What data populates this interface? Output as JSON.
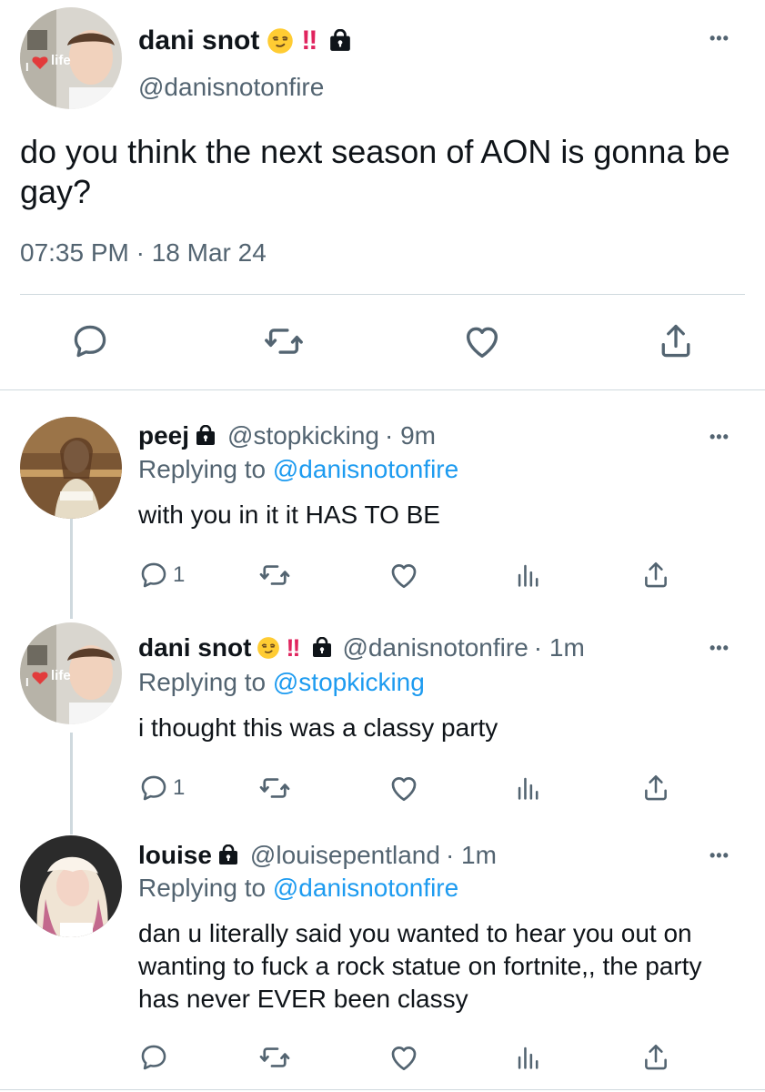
{
  "main_tweet": {
    "name": "dani snot",
    "bang": "!!",
    "handle": "@danisnotonfire",
    "text": "do you think the next season of AON is gonna be gay?",
    "timestamp": "07:35 PM · 18 Mar 24",
    "more": "•••",
    "avatar_sign": "life",
    "avatar_sign_prefix": "I"
  },
  "replies": [
    {
      "name": "peej",
      "handle": "@stopkicking",
      "time": "· 9m",
      "replying_prefix": "Replying to",
      "replying_to": "@danisnotonfire",
      "text": "with you in it it HAS TO BE",
      "reply_count": "1",
      "more": "•••"
    },
    {
      "name": "dani snot",
      "bang": "!!",
      "handle": "@danisnotonfire",
      "time": "· 1m",
      "replying_prefix": "Replying to",
      "replying_to": "@stopkicking",
      "text": "i thought this was a classy party",
      "reply_count": "1",
      "more": "•••",
      "avatar_sign": "life",
      "avatar_sign_prefix": "I"
    },
    {
      "name": "louise",
      "handle": "@louisepentland",
      "time": "· 1m",
      "replying_prefix": "Replying to",
      "replying_to": "@danisnotonfire",
      "text": "dan u literally said you wanted to hear you out on wanting to fuck a rock statue on fortnite,, the party has never EVER been classy",
      "reply_count": "",
      "more": "•••"
    }
  ],
  "colors": {
    "text": "#0f1419",
    "secondary": "#536471",
    "link": "#1d9bf0",
    "divider": "#cfd9de",
    "bang": "#e0245e"
  },
  "icons": {
    "reply": "speech-bubble-icon",
    "retweet": "retweet-icon",
    "like": "heart-icon",
    "analytics": "bar-chart-icon",
    "share": "share-icon",
    "lock": "lock-icon",
    "emoji": "smirk-emoji-icon"
  }
}
